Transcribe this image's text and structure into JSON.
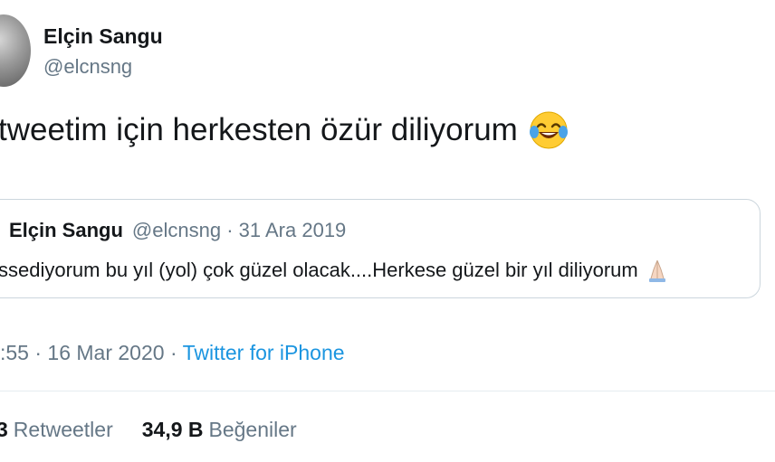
{
  "author": {
    "name": "Elçin Sangu",
    "handle": "@elcnsng"
  },
  "tweet": {
    "text": "tweetim için herkesten özür diliyorum",
    "emoji": "face-with-tears-of-joy"
  },
  "quoted_tweet": {
    "name": "Elçin Sangu",
    "meta": "@elcnsng · 31 Ara 2019",
    "text": "ssediyorum bu yıl (yol) çok güzel olacak....Herkese güzel bir yıl diliyorum",
    "emoji": "folded-hands"
  },
  "meta": {
    "time_date": ":55 · 16 Mar 2020 · ",
    "source": "Twitter for iPhone"
  },
  "stats": {
    "retweets_count": "3",
    "retweets_label": "Retweetler",
    "likes_count": "34,9 B",
    "likes_label": "Beğeniler"
  },
  "colors": {
    "link": "#1b95e0",
    "secondary_text": "#657786",
    "border": "#ccd6dd"
  }
}
